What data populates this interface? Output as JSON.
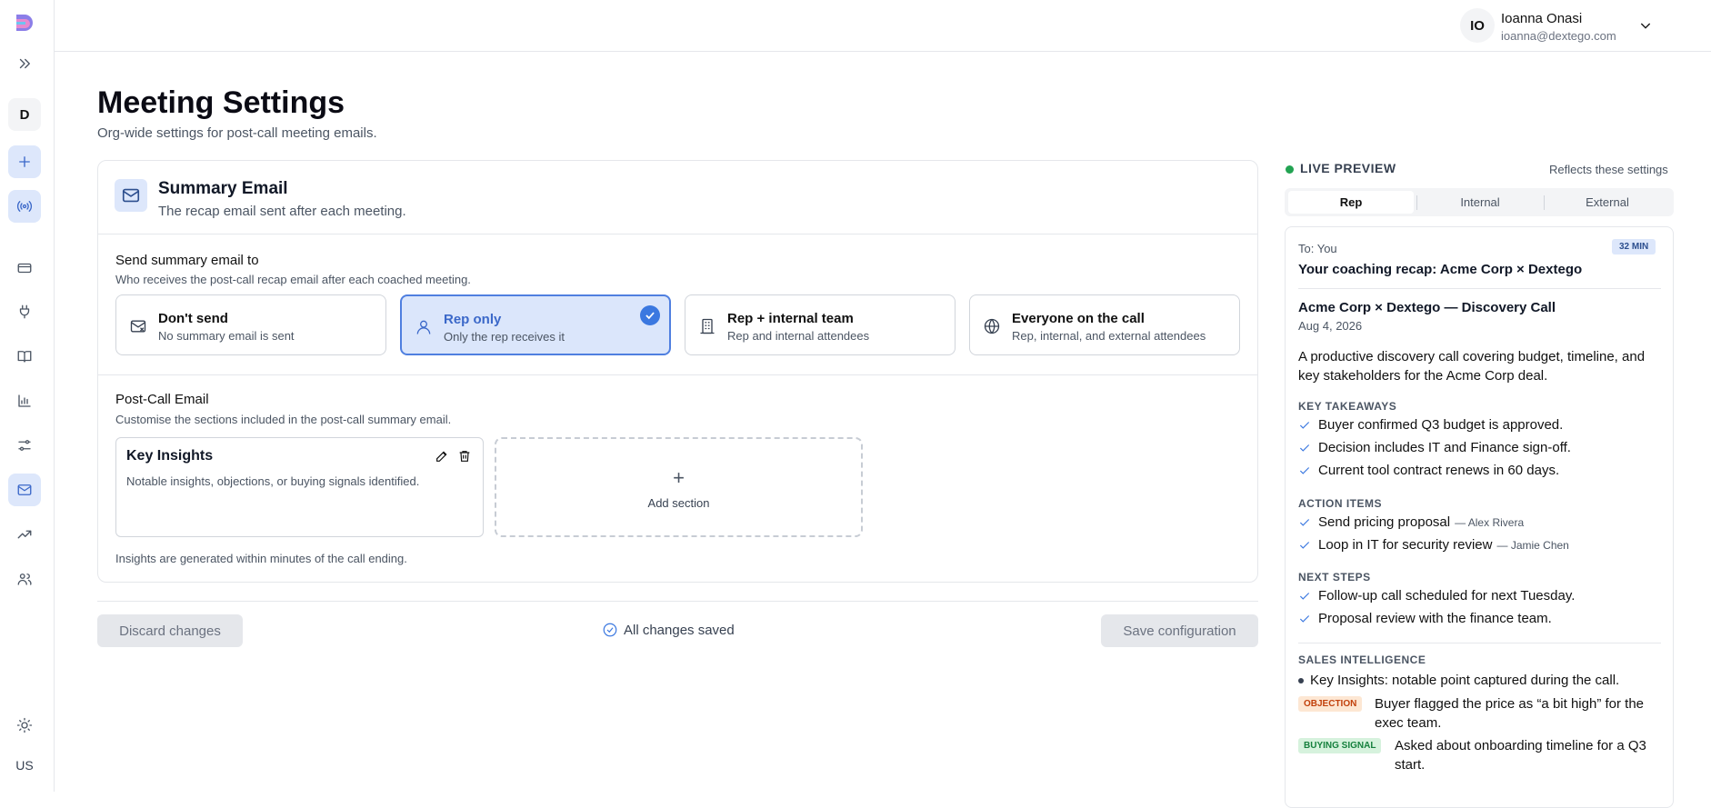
{
  "sidebar": {
    "workspace_initial": "D",
    "locale": "US"
  },
  "user": {
    "initials": "IO",
    "name": "Ioanna Onasi",
    "email": "ioanna@dextego.com"
  },
  "page": {
    "title": "Meeting Settings",
    "subtitle": "Org-wide settings for post-call meeting emails."
  },
  "card": {
    "title": "Summary Email",
    "subtitle": "The recap email sent after each meeting.",
    "send_to": {
      "title": "Send summary email to",
      "subtitle": "Who receives the post-call recap email after each coached meeting.",
      "options": [
        {
          "title": "Don't send",
          "desc": "No summary email is sent",
          "selected": false
        },
        {
          "title": "Rep only",
          "desc": "Only the rep receives it",
          "selected": true
        },
        {
          "title": "Rep + internal team",
          "desc": "Rep and internal attendees",
          "selected": false
        },
        {
          "title": "Everyone on the call",
          "desc": "Rep, internal, and external attendees",
          "selected": false
        }
      ]
    },
    "post_call": {
      "title": "Post-Call Email",
      "subtitle": "Customise the sections included in the post-call summary email.",
      "sections": [
        {
          "title": "Key Insights",
          "desc": "Notable insights, objections, or buying signals identified."
        }
      ],
      "add_plus": "+",
      "add_label": "Add section",
      "note": "Insights are generated within minutes of the call ending."
    }
  },
  "footer": {
    "discard": "Discard changes",
    "status": "All changes saved",
    "save": "Save configuration"
  },
  "preview": {
    "label": "LIVE PREVIEW",
    "reflects": "Reflects these settings",
    "tabs": [
      "Rep",
      "Internal",
      "External"
    ],
    "active_tab": "Rep",
    "to": "To: You",
    "duration": "32 MIN",
    "subject": "Your coaching recap: Acme Corp × Dextego",
    "meeting_title": "Acme Corp × Dextego — Discovery Call",
    "meeting_date": "Aug 4, 2026",
    "summary": "A productive discovery call covering budget, timeline, and key stakeholders for the Acme Corp deal.",
    "key_takeaways": {
      "heading": "KEY TAKEAWAYS",
      "items": [
        "Buyer confirmed Q3 budget is approved.",
        "Decision includes IT and Finance sign-off.",
        "Current tool contract renews in 60 days."
      ]
    },
    "action_items": {
      "heading": "ACTION ITEMS",
      "items": [
        {
          "text": "Send pricing proposal",
          "owner": "— Alex Rivera"
        },
        {
          "text": "Loop in IT for security review",
          "owner": "— Jamie Chen"
        }
      ]
    },
    "next_steps": {
      "heading": "NEXT STEPS",
      "items": [
        "Follow-up call scheduled for next Tuesday.",
        "Proposal review with the finance team."
      ]
    },
    "sales_intelligence": {
      "heading": "SALES INTELLIGENCE",
      "bullet": "Key Insights: notable point captured during the call.",
      "objection_tag": "OBJECTION",
      "objection_text": "Buyer flagged the price as “a bit high” for the exec team.",
      "buying_tag": "BUYING SIGNAL",
      "buying_text": "Asked about onboarding timeline for a Q3 start."
    }
  },
  "colors": {
    "accent": "#3b78e0",
    "selected_bg": "#dbe6fb",
    "live_dot": "#22a352",
    "objection": "#c2410c",
    "buying_signal": "#15803d"
  }
}
